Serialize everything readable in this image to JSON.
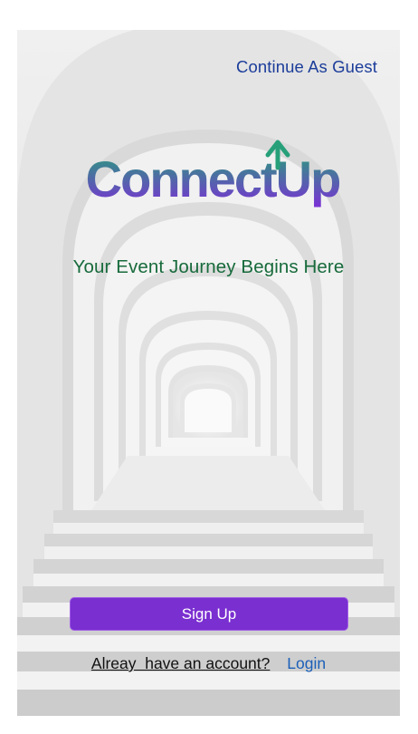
{
  "header": {
    "guest_link": "Continue As Guest"
  },
  "brand": {
    "logo_text": "ConnectUp",
    "gradient_start": "#27a07a",
    "gradient_end": "#7b2fd6"
  },
  "hero": {
    "tagline": "Your Event Journey Begins Here"
  },
  "actions": {
    "signup_label": "Sign Up",
    "account_question": "Alreay  have an account?",
    "login_label": "Login"
  },
  "colors": {
    "accent": "#7a2fd0",
    "link": "#1c3d9a",
    "tagline": "#176a3b",
    "background": "#e9e9e9"
  }
}
